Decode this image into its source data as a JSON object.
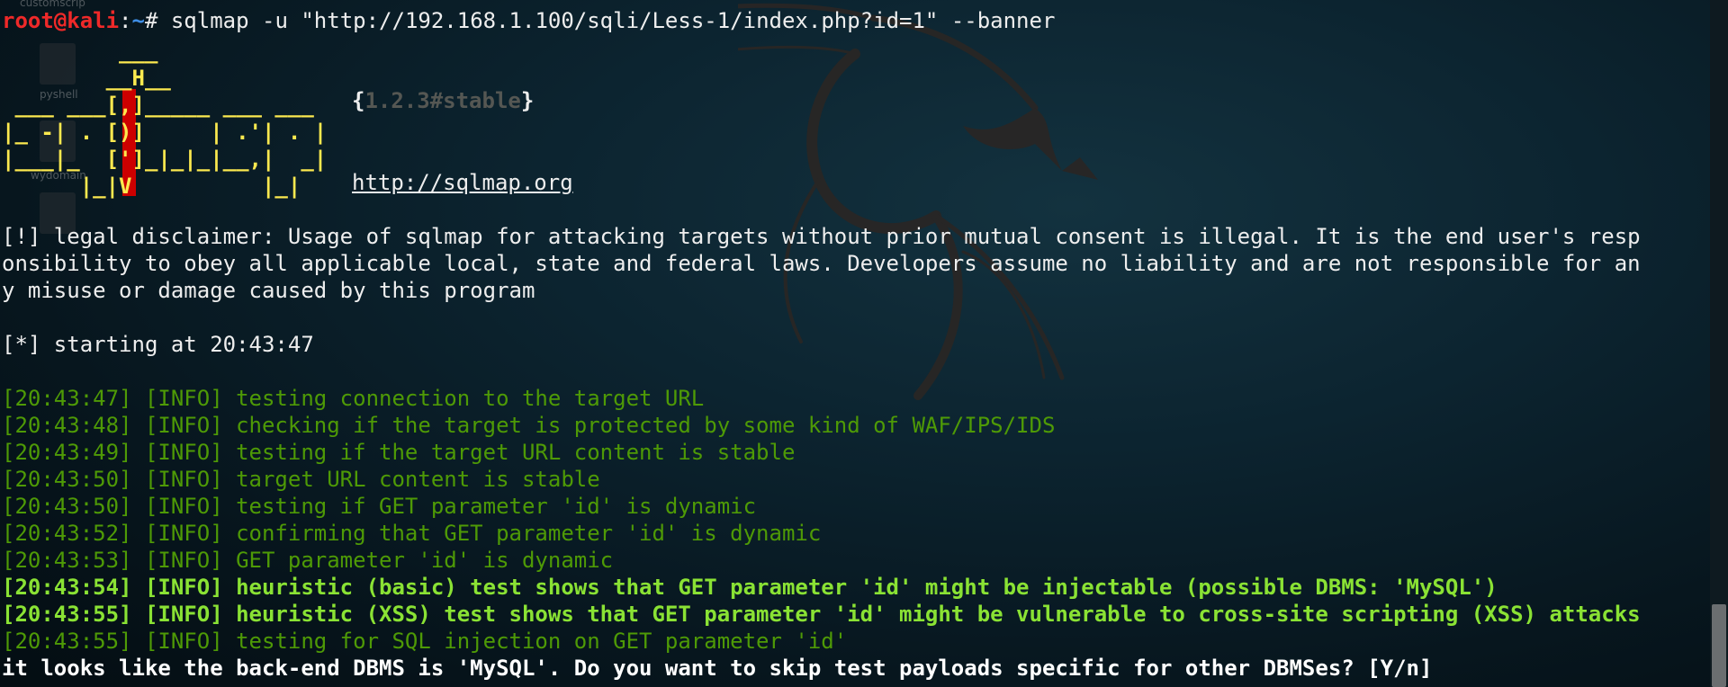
{
  "desktop": {
    "icons": [
      {
        "label": "customscrip",
        "icon": "file-icon"
      },
      {
        "label": "pyshell",
        "icon": "file-icon"
      },
      {
        "label": "wydomain",
        "icon": "file-icon"
      },
      {
        "label": "",
        "icon": "file-icon"
      }
    ]
  },
  "terminal": {
    "prompt": {
      "user": "root@kali",
      "separator": ":",
      "path": "~",
      "symbol": "# ",
      "command": "sqlmap -u \"http://192.168.1.100/sqli/Less-1/index.php?id=1\" --banner"
    },
    "banner": {
      "ascii": "         ___\n        __H__\n ___ ___[,]_____ ___ ___\n|_ -| . [)]     | .'| . |\n|___|_  [']_|_|_|__,|  _|\n      |_|V          |_|",
      "version_open": "{",
      "version": "1.2.3#stable",
      "version_close": "}",
      "url": "http://sqlmap.org"
    },
    "disclaimer": [
      "[!] legal disclaimer: Usage of sqlmap for attacking targets without prior mutual consent is illegal. It is the end user's resp",
      "onsibility to obey all applicable local, state and federal laws. Developers assume no liability and are not responsible for an",
      "y misuse or damage caused by this program"
    ],
    "start": "[*] starting at 20:43:47",
    "log": [
      {
        "text": "[20:43:47] [INFO] testing connection to the target URL",
        "style": "info"
      },
      {
        "text": "[20:43:48] [INFO] checking if the target is protected by some kind of WAF/IPS/IDS",
        "style": "info"
      },
      {
        "text": "[20:43:49] [INFO] testing if the target URL content is stable",
        "style": "info"
      },
      {
        "text": "[20:43:50] [INFO] target URL content is stable",
        "style": "info"
      },
      {
        "text": "[20:43:50] [INFO] testing if GET parameter 'id' is dynamic",
        "style": "info"
      },
      {
        "text": "[20:43:52] [INFO] confirming that GET parameter 'id' is dynamic",
        "style": "info"
      },
      {
        "text": "[20:43:53] [INFO] GET parameter 'id' is dynamic",
        "style": "info"
      },
      {
        "text": "[20:43:54] [INFO] heuristic (basic) test shows that GET parameter 'id' might be injectable (possible DBMS: 'MySQL')",
        "style": "info-bold"
      },
      {
        "text": "[20:43:55] [INFO] heuristic (XSS) test shows that GET parameter 'id' might be vulnerable to cross-site scripting (XSS) attacks",
        "style": "info-bold"
      },
      {
        "text": "[20:43:55] [INFO] testing for SQL injection on GET parameter 'id'",
        "style": "info"
      }
    ],
    "question": "it looks like the back-end DBMS is 'MySQL'. Do you want to skip test payloads specific for other DBMSes? [Y/n]"
  },
  "colors": {
    "prompt_user": "#ef2929",
    "prompt_path": "#3e8ee6",
    "banner": "#fce94f",
    "info": "#4e9a06",
    "info_bold": "#8ae234",
    "text": "#eeeeee"
  }
}
